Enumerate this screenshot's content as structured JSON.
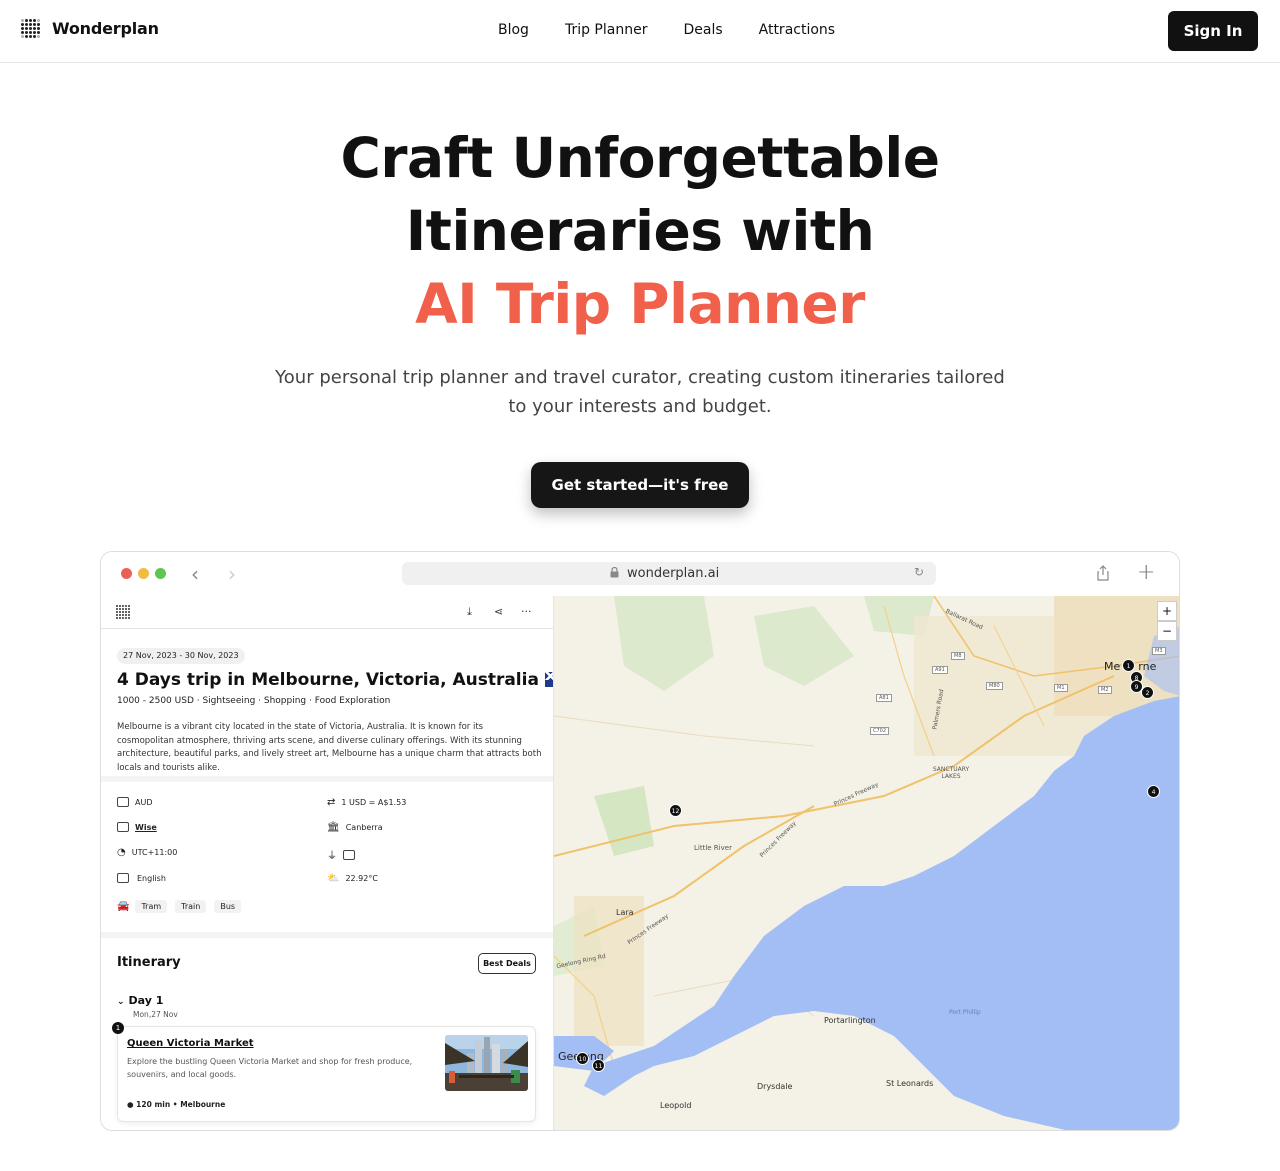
{
  "nav": {
    "brand": "Wonderplan",
    "links": [
      "Blog",
      "Trip Planner",
      "Deals",
      "Attractions"
    ],
    "signin": "Sign In"
  },
  "hero": {
    "line1": "Craft Unforgettable",
    "line2": "Itineraries with",
    "line3": "AI Trip Planner",
    "subtitle": "Your personal trip planner and travel curator, creating custom itineraries tailored to your interests and budget.",
    "cta": "Get started—it's free",
    "accent_color": "#f0604a"
  },
  "browser": {
    "url": "wonderplan.ai"
  },
  "trip": {
    "dates": "27 Nov, 2023 - 30 Nov, 2023",
    "title": "4 Days trip in Melbourne, Victoria, Australia",
    "meta": "1000 - 2500 USD · Sightseeing · Shopping · Food Exploration",
    "description": "Melbourne is a vibrant city located in the state of Victoria, Australia. It is known for its cosmopolitan atmosphere, thriving arts scene, and diverse culinary offerings. With its stunning architecture, beautiful parks, and lively street art, Melbourne has a unique charm that attracts both locals and tourists alike.",
    "info": {
      "currency": "AUD",
      "exchange": "1 USD = A$1.53",
      "payment": "Wise",
      "capital": "Canberra",
      "timezone": "UTC+11:00",
      "language": "English",
      "weather": "22.92°C",
      "transport": [
        "Tram",
        "Train",
        "Bus"
      ]
    }
  },
  "itinerary": {
    "title": "Itinerary",
    "deals_button": "Best Deals",
    "day_label": "Day 1",
    "day_date": "Mon,27 Nov",
    "first_step": "1",
    "place": {
      "name": "Queen Victoria Market",
      "description": "Explore the bustling Queen Victoria Market and shop for fresh produce, souvenirs, and local goods.",
      "duration": "120 min",
      "location": "Melbourne"
    }
  },
  "map": {
    "labels": {
      "city": "Melbourne",
      "city_partial": "Me",
      "city_partial_end": "rne",
      "geelong": "Geelong",
      "little_river": "Little River",
      "lara": "Lara",
      "portarlington": "Portarlington",
      "drysdale": "Drysdale",
      "st_leonards": "St Leonards",
      "leopold": "Leopold",
      "sanctuary_lakes": "SANCTUARY LAKES",
      "port_phillip": "Port Phillip",
      "princes_fwy": "Princes Freeway",
      "ballarat_rd": "Ballarat Road",
      "geelong_ring": "Geelong Ring Rd",
      "palmers_rd": "Palmers Road",
      "m80": "M80",
      "m1": "M1",
      "m2": "M2",
      "m3": "M3",
      "a81": "A81",
      "a91": "A91",
      "c702": "C702",
      "m8": "M8"
    },
    "markers": [
      "1",
      "2",
      "4",
      "8",
      "9",
      "10",
      "11",
      "12"
    ],
    "zoom_in": "+",
    "zoom_out": "−",
    "water_color": "#a3bdf5",
    "land_color": "#f4f1e6",
    "park_color": "#d8e8c8"
  }
}
